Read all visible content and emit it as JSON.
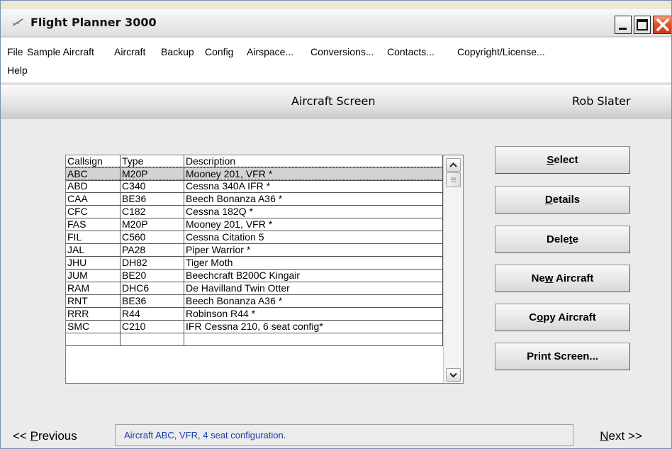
{
  "window": {
    "title": "Flight Planner 3000"
  },
  "menu": {
    "row1": [
      "File",
      "Sample Aircraft",
      "Aircraft",
      "Backup",
      "Config",
      "Airspace...",
      "Conversions...",
      "Contacts...",
      "Copyright/License..."
    ],
    "row2": [
      "Help"
    ]
  },
  "header": {
    "screen_title": "Aircraft Screen",
    "user_name": "Rob Slater"
  },
  "table": {
    "columns": [
      "Callsign",
      "Type",
      "Description"
    ],
    "selected_row": 0,
    "rows": [
      [
        "ABC",
        "M20P",
        "Mooney 201, VFR *"
      ],
      [
        "ABD",
        " C340",
        "Cessna 340A IFR *"
      ],
      [
        "CAA",
        "BE36",
        "Beech Bonanza A36 *"
      ],
      [
        "CFC",
        "C182",
        "Cessna 182Q *"
      ],
      [
        "FAS",
        "M20P",
        "Mooney 201, VFR *"
      ],
      [
        "FIL",
        "C560",
        "Cessna Citation 5"
      ],
      [
        "JAL",
        "PA28",
        "Piper Warrior *"
      ],
      [
        "JHU",
        "DH82",
        "Tiger Moth"
      ],
      [
        "JUM",
        "BE20",
        "Beechcraft B200C Kingair"
      ],
      [
        "RAM",
        "DHC6",
        "De Havilland Twin Otter"
      ],
      [
        "RNT",
        "BE36",
        "Beech Bonanza A36 *"
      ],
      [
        "RRR",
        "R44",
        "Robinson R44 *"
      ],
      [
        "SMC",
        "C210",
        "IFR Cessna 210, 6 seat config*"
      ]
    ]
  },
  "buttons": {
    "select": {
      "pre": "",
      "key": "S",
      "post": "elect"
    },
    "details": {
      "pre": "",
      "key": "D",
      "post": "etails"
    },
    "delete": {
      "pre": "Dele",
      "key": "t",
      "post": "e"
    },
    "new_aircraft": {
      "pre": "Ne",
      "key": "w",
      "post": " Aircraft"
    },
    "copy_aircraft": {
      "pre": "C",
      "key": "o",
      "post": "py Aircraft"
    },
    "print_screen": {
      "pre": "Print Screen...",
      "key": "",
      "post": ""
    }
  },
  "status": {
    "prev": {
      "pre": "<< ",
      "key": "P",
      "post": "revious"
    },
    "message": "Aircraft ABC, VFR, 4 seat configuration.",
    "next": {
      "pre": "",
      "key": "N",
      "post": "ext >>"
    }
  },
  "colors": {
    "status_text": "#1a3aa8",
    "selected_row": "#d3d3d3",
    "close_button": "#e05330"
  },
  "icons": [
    "airplane-icon",
    "minimize-icon",
    "maximize-icon",
    "close-icon",
    "scroll-up-icon",
    "scroll-down-icon"
  ]
}
